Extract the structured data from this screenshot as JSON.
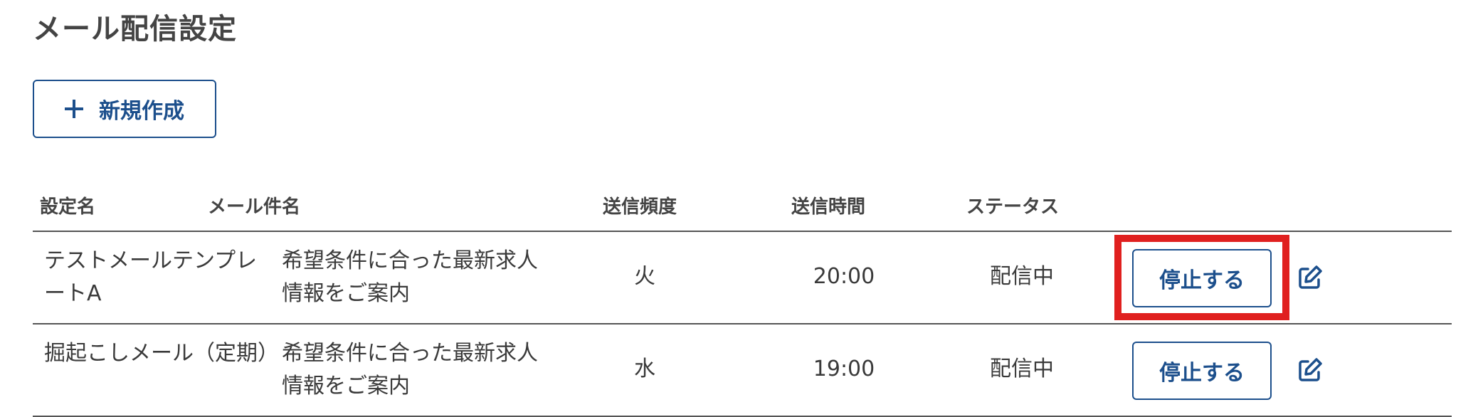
{
  "page": {
    "title": "メール配信設定"
  },
  "toolbar": {
    "new_label": "新規作成"
  },
  "table": {
    "headers": {
      "name": "設定名",
      "subject": "メール件名",
      "frequency": "送信頻度",
      "time": "送信時間",
      "status": "ステータス"
    },
    "rows": [
      {
        "name": "テストメールテンプレートA",
        "subject": "希望条件に合った最新求人情報をご案内",
        "frequency": "火",
        "time": "20:00",
        "status": "配信中",
        "action": "停止する",
        "action_highlighted": true
      },
      {
        "name": "掘起こしメール（定期）",
        "subject": "希望条件に合った最新求人情報をご案内",
        "frequency": "水",
        "time": "19:00",
        "status": "配信中",
        "action": "停止する",
        "action_highlighted": false
      }
    ]
  },
  "icons": {
    "add": "plus-icon",
    "edit": "edit-icon"
  },
  "colors": {
    "accent": "#1c4f8c",
    "highlight": "#e0201f",
    "text": "#3a3a3a"
  }
}
